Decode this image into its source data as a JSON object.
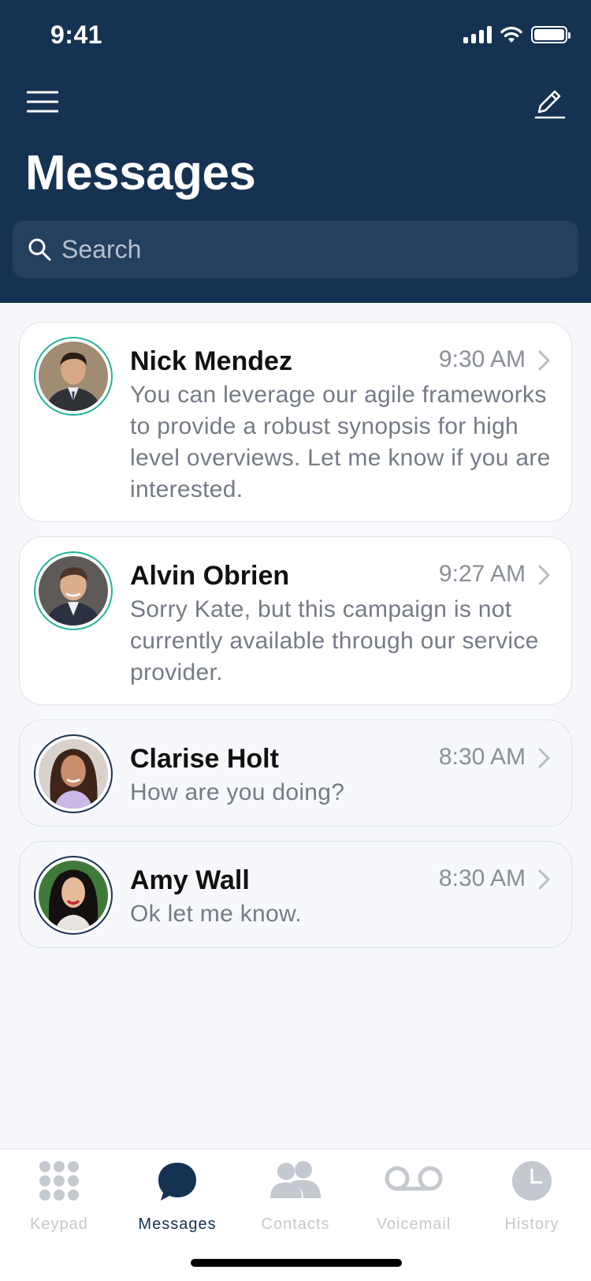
{
  "status_bar": {
    "time": "9:41"
  },
  "header": {
    "title": "Messages"
  },
  "search": {
    "placeholder": "Search"
  },
  "messages": [
    {
      "name": "Nick Mendez",
      "time": "9:30 AM",
      "preview": "You can leverage our agile frameworks to provide a robust synopsis for high level overviews. Let me know if you are interested.",
      "unread": true
    },
    {
      "name": "Alvin Obrien",
      "time": "9:27 AM",
      "preview": "Sorry Kate, but this campaign is not currently available through our service provider.",
      "unread": true
    },
    {
      "name": "Clarise Holt",
      "time": "8:30 AM",
      "preview": "How are you doing?",
      "unread": false
    },
    {
      "name": "Amy Wall",
      "time": "8:30 AM",
      "preview": "Ok let me know.",
      "unread": false
    }
  ],
  "tabs": [
    {
      "label": "Keypad",
      "icon": "keypad-icon"
    },
    {
      "label": "Messages",
      "icon": "chat-bubble-icon",
      "active": true
    },
    {
      "label": "Contacts",
      "icon": "contacts-icon"
    },
    {
      "label": "Voicemail",
      "icon": "voicemail-icon"
    },
    {
      "label": "History",
      "icon": "clock-icon"
    }
  ],
  "colors": {
    "header_bg": "#163252",
    "unread_ring": "#24b49a",
    "read_ring": "#1c3350",
    "tab_active": "#163252",
    "tab_inactive": "#c4c8cf"
  }
}
